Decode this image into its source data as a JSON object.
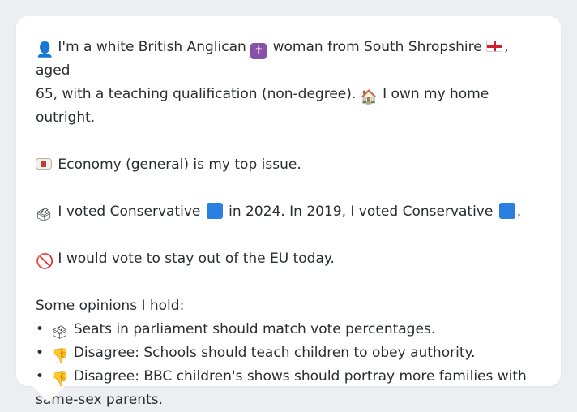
{
  "profile": {
    "line1_a": "I'm a white British Anglican",
    "line1_b": "woman from South Shropshire",
    "line1_c": ", aged",
    "line2": "65, with a teaching qualification (non-degree).",
    "line2_b": "I own my home outright."
  },
  "issue": {
    "text": "Economy (general) is my top issue."
  },
  "votes": {
    "part_a": "I voted Conservative",
    "part_b": "in 2024. In 2019, I voted Conservative",
    "part_c": "."
  },
  "eu": {
    "text": "I would vote to stay out of the EU today."
  },
  "opinions": {
    "heading": "Some opinions I hold:",
    "items": [
      {
        "bullet": "•",
        "text": "Seats in parliament should match vote percentages."
      },
      {
        "bullet": "•",
        "text": "Disagree: Schools should teach children to obey authority."
      },
      {
        "bullet": "•",
        "text": "Disagree: BBC children's shows should portray more families with"
      },
      {
        "text": "same-sex parents."
      }
    ]
  },
  "icons": {
    "person": "person-icon",
    "cross": "latin-cross-icon",
    "flag": "england-flag-icon",
    "house": "house-icon",
    "money": "banknote-icon",
    "ballot": "ballot-box-icon",
    "square": "blue-square-icon",
    "prohibited": "prohibited-icon",
    "thumb": "thumbs-down-icon"
  },
  "colors": {
    "card": "#ffffff",
    "background": "#eceef1",
    "conservative_blue": "#2a7fe0",
    "cross_purple": "#8a4fa9"
  }
}
